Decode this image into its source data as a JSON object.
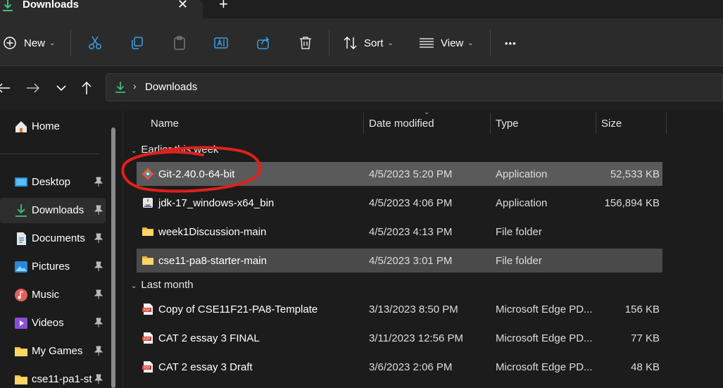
{
  "window": {
    "tab_title": "Downloads",
    "close_glyph": "✕",
    "new_tab_glyph": "+"
  },
  "toolbar": {
    "new_label": "New",
    "sort_label": "Sort",
    "view_label": "View",
    "more_label": "•••",
    "icons": [
      "plus-circle-icon",
      "cut-icon",
      "copy-icon",
      "paste-icon",
      "rename-icon",
      "share-icon",
      "delete-icon",
      "sort-icon",
      "view-icon"
    ]
  },
  "address": {
    "current": "Downloads",
    "separator": "›"
  },
  "sidebar": {
    "items": [
      {
        "label": "Home",
        "icon": "home-icon",
        "pinned": false
      },
      {
        "label": "Desktop",
        "icon": "desktop-icon",
        "pinned": true
      },
      {
        "label": "Downloads",
        "icon": "download-icon",
        "pinned": true,
        "active": true
      },
      {
        "label": "Documents",
        "icon": "documents-icon",
        "pinned": true
      },
      {
        "label": "Pictures",
        "icon": "pictures-icon",
        "pinned": true
      },
      {
        "label": "Music",
        "icon": "music-icon",
        "pinned": true
      },
      {
        "label": "Videos",
        "icon": "videos-icon",
        "pinned": true
      },
      {
        "label": "My Games",
        "icon": "folder-icon",
        "pinned": true
      },
      {
        "label": "cse11-pa1-st",
        "icon": "folder-icon",
        "pinned": true
      }
    ]
  },
  "columns": {
    "name": "Name",
    "date": "Date modified",
    "type": "Type",
    "size": "Size"
  },
  "groups": [
    {
      "label": "Earlier this week",
      "rows": [
        {
          "name": "Git-2.40.0-64-bit",
          "date": "4/5/2023 5:20 PM",
          "type": "Application",
          "size": "52,533 KB",
          "icon": "git-installer-icon"
        },
        {
          "name": "jdk-17_windows-x64_bin",
          "date": "4/5/2023 4:06 PM",
          "type": "Application",
          "size": "156,894 KB",
          "icon": "java-installer-icon"
        },
        {
          "name": "week1Discussion-main",
          "date": "4/5/2023 4:13 PM",
          "type": "File folder",
          "size": "",
          "icon": "folder-icon"
        },
        {
          "name": "cse11-pa8-starter-main",
          "date": "4/5/2023 3:01 PM",
          "type": "File folder",
          "size": "",
          "icon": "folder-icon"
        }
      ]
    },
    {
      "label": "Last month",
      "rows": [
        {
          "name": "Copy of CSE11F21-PA8-Template",
          "date": "3/13/2023 8:50 PM",
          "type": "Microsoft Edge PD...",
          "size": "156 KB",
          "icon": "pdf-icon"
        },
        {
          "name": "CAT 2 essay 3 FINAL",
          "date": "3/11/2023 12:56 PM",
          "type": "Microsoft Edge PD...",
          "size": "77 KB",
          "icon": "pdf-icon"
        },
        {
          "name": "CAT 2 essay 3 Draft",
          "date": "3/6/2023 2:06 PM",
          "type": "Microsoft Edge PD...",
          "size": "48 KB",
          "icon": "pdf-icon"
        }
      ]
    }
  ],
  "colors": {
    "accent_green": "#3fbf7f",
    "folder_yellow": "#f5c542",
    "pdf_red": "#d93a2b",
    "annotation_red": "#e0201b"
  }
}
